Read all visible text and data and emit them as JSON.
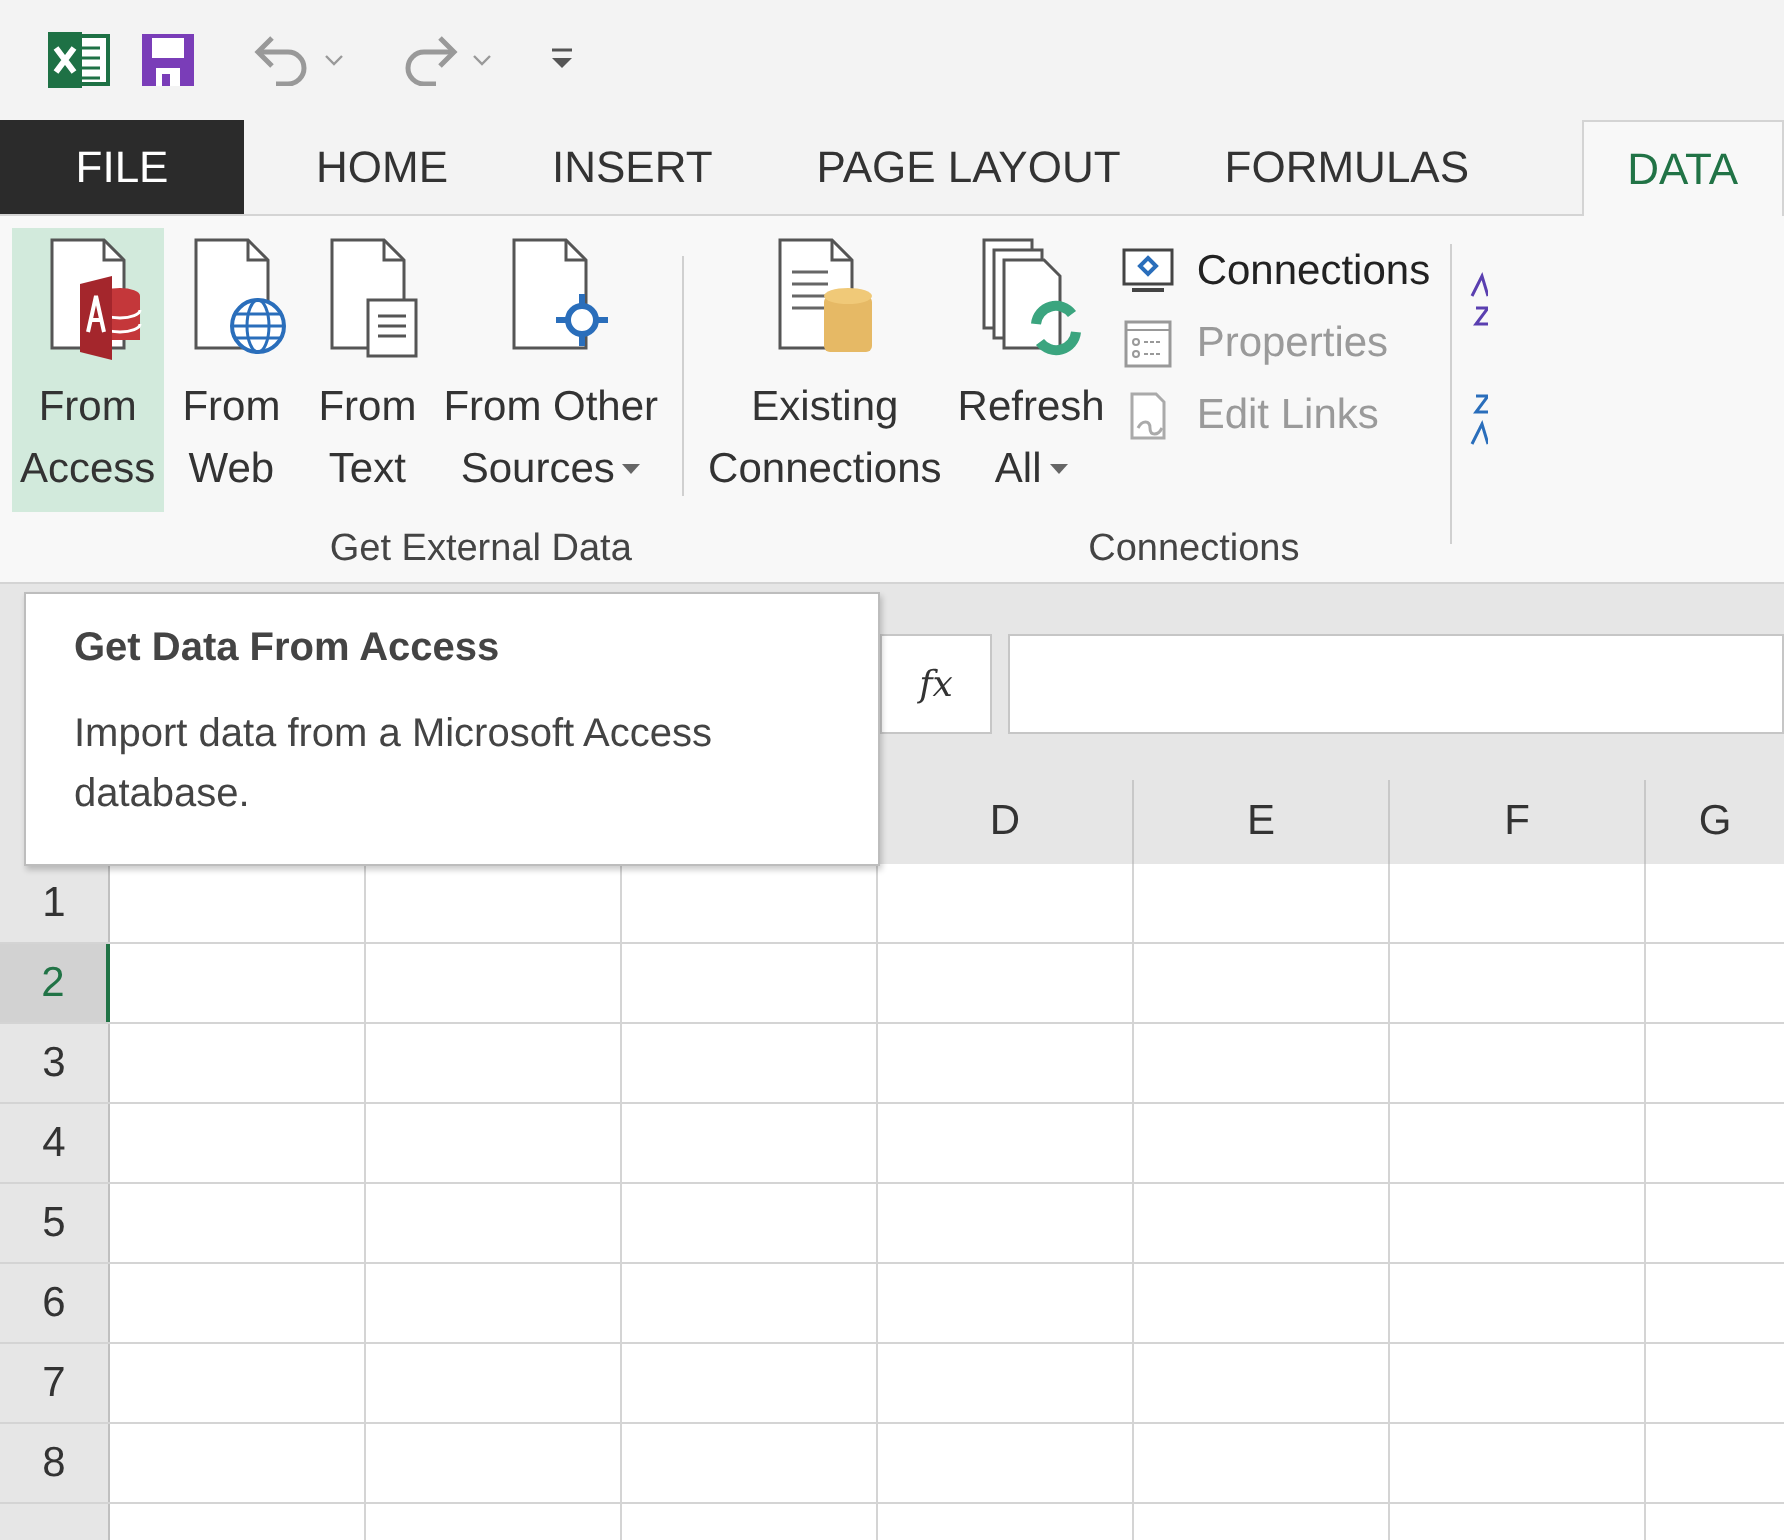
{
  "tabs": [
    {
      "label": "FILE",
      "kind": "file",
      "selected": false
    },
    {
      "label": "HOME",
      "kind": "tab",
      "selected": false
    },
    {
      "label": "INSERT",
      "kind": "tab",
      "selected": false
    },
    {
      "label": "PAGE LAYOUT",
      "kind": "tab",
      "selected": false
    },
    {
      "label": "FORMULAS",
      "kind": "tab",
      "selected": false
    },
    {
      "label": "DATA",
      "kind": "tab",
      "selected": true
    }
  ],
  "ribbon": {
    "groups": [
      {
        "label": "Get External Data",
        "buttons": [
          {
            "lines": [
              "From",
              "Access"
            ],
            "highlighted": true,
            "dropdown": false
          },
          {
            "lines": [
              "From",
              "Web"
            ],
            "highlighted": false,
            "dropdown": false
          },
          {
            "lines": [
              "From",
              "Text"
            ],
            "highlighted": false,
            "dropdown": false
          },
          {
            "lines": [
              "From Other",
              "Sources"
            ],
            "highlighted": false,
            "dropdown": true
          },
          {
            "lines": [
              "Existing",
              "Connections"
            ],
            "highlighted": false,
            "dropdown": false
          }
        ]
      },
      {
        "label": "Connections",
        "buttons": [
          {
            "lines": [
              "Refresh",
              "All"
            ],
            "highlighted": false,
            "dropdown": true
          }
        ],
        "small_items": [
          {
            "label": "Connections",
            "disabled": false
          },
          {
            "label": "Properties",
            "disabled": true
          },
          {
            "label": "Edit Links",
            "disabled": true
          }
        ]
      }
    ]
  },
  "tooltip": {
    "title": "Get Data From Access",
    "text": "Import data from a Microsoft Access database."
  },
  "formula_bar": {
    "function_label": "fx"
  },
  "sheet": {
    "columns": [
      {
        "label": "D"
      },
      {
        "label": "E"
      },
      {
        "label": "F"
      },
      {
        "label": "G"
      }
    ],
    "rows": [
      {
        "label": "1",
        "selected": false
      },
      {
        "label": "2",
        "selected": true
      },
      {
        "label": "3",
        "selected": false
      },
      {
        "label": "4",
        "selected": false
      },
      {
        "label": "5",
        "selected": false
      },
      {
        "label": "6",
        "selected": false
      },
      {
        "label": "7",
        "selected": false
      },
      {
        "label": "8",
        "selected": false
      }
    ]
  }
}
